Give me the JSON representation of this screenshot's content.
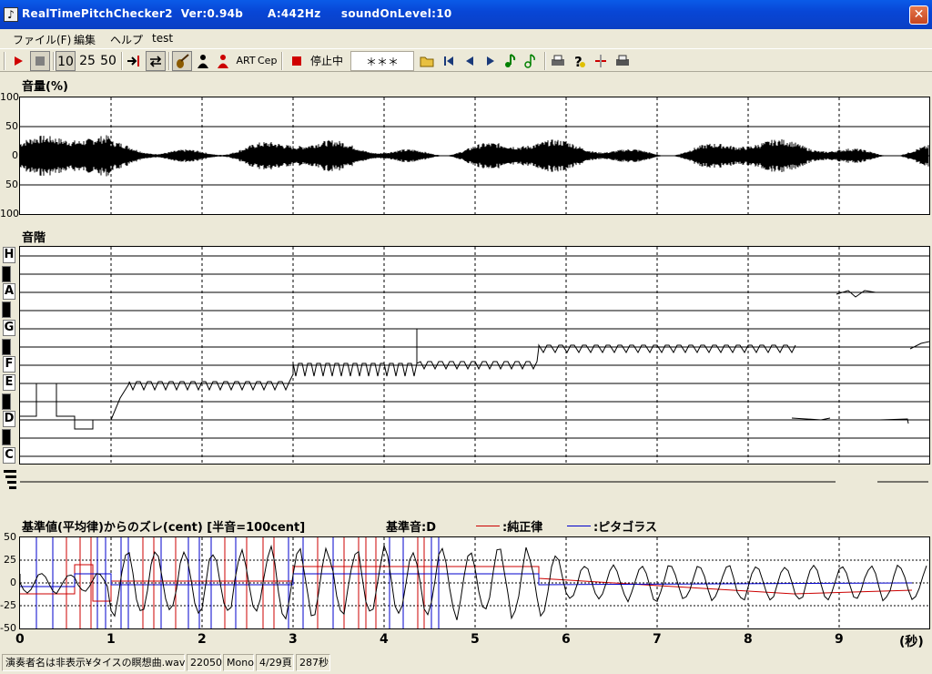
{
  "window": {
    "title": "RealTimePitchChecker2  Ver:0.94b      A:442Hz     soundOnLevel:10",
    "close_glyph": "✕",
    "icon_glyph": "♪"
  },
  "menu": [
    "ファイル(F)",
    "編集",
    "ヘルプ",
    "test"
  ],
  "toolbar": {
    "n10": "10",
    "n25": "25",
    "n50": "50",
    "art": "ART",
    "cep": "Cep",
    "status": "停止中",
    "stars": "＊＊＊"
  },
  "volume": {
    "title": "音量(%)",
    "yticks": [
      "100",
      "50",
      "0",
      "50",
      "100"
    ]
  },
  "scale": {
    "title": "音階",
    "notes": [
      "H",
      "A",
      "G",
      "F",
      "E",
      "D",
      "C"
    ]
  },
  "deviation": {
    "title": "基準値(平均律)からのズレ(cent) [半音=100cent]",
    "base": "基準音:D",
    "legend_just": ":純正律",
    "legend_pyth": ":ピタゴラス",
    "yticks": [
      "50",
      "25",
      "0",
      "-25",
      "-50"
    ],
    "colors": {
      "just": "#cc0000",
      "pythagorean": "#0000cc"
    }
  },
  "time_axis": {
    "ticks": [
      "0",
      "1",
      "2",
      "3",
      "4",
      "5",
      "6",
      "7",
      "8",
      "9"
    ],
    "unit": "(秒)"
  },
  "statusbar": {
    "file": "演奏者名は非表示¥タイスの瞑想曲.wav",
    "rate": "22050",
    "channels": "Mono",
    "page": "4/29頁",
    "duration": "287秒"
  }
}
